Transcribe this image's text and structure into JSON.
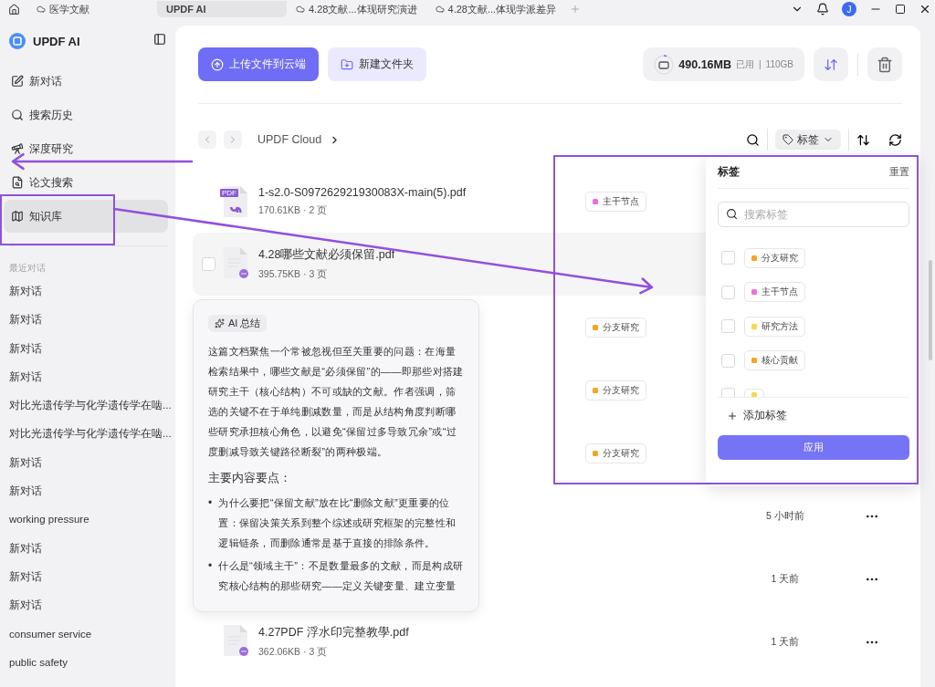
{
  "title_bar": {
    "tabs": [
      {
        "label": "医学文献",
        "selected": false,
        "cloud": true
      },
      {
        "label": "UPDF AI",
        "selected": true,
        "cloud": false
      },
      {
        "label": "4.28文献...体现研究演进",
        "selected": false,
        "cloud": true
      },
      {
        "label": "4.28文献...体现学派差异",
        "selected": false,
        "cloud": true
      }
    ],
    "avatar": "J"
  },
  "sidebar": {
    "app_name": "UPDF AI",
    "nav": [
      {
        "label": "新对话",
        "selected": false
      },
      {
        "label": "搜索历史",
        "selected": false
      },
      {
        "label": "深度研究",
        "selected": false
      },
      {
        "label": "论文搜索",
        "selected": false
      },
      {
        "label": "知识库",
        "selected": true
      }
    ],
    "recent_heading": "最近对话",
    "recent": [
      "新对话",
      "新对话",
      "新对话",
      "新对话",
      "对比光遗传学与化学遗传学在啮...",
      "对比光遗传学与化学遗传学在啮...",
      "新对话",
      "新对话",
      "working pressure",
      "新对话",
      "新对话",
      "新对话",
      "consumer service",
      "public safety"
    ]
  },
  "toolbar": {
    "upload": "上传文件到云端",
    "new_folder": "新建文件夹",
    "storage": {
      "used": "490.16MB",
      "used_label": "已用",
      "separator": "|",
      "total": "110GB"
    }
  },
  "breadcrumb": {
    "path": "UPDF Cloud"
  },
  "tag_filter": "标签",
  "files": [
    {
      "kind": "pdf",
      "badge": "PDF",
      "name": "1-s2.0-S097262921930083X-main(5).pdf",
      "meta": "170.61KB · 2 页",
      "hovered": false,
      "tag": {
        "label": "主干节点",
        "color": "#f06be0"
      }
    },
    {
      "kind": "doc",
      "name": "4.28哪些文献必须保留.pdf",
      "meta": "395.75KB · 3 页",
      "hovered": true
    },
    {
      "tag": {
        "label": "分支研究",
        "color": "#f5a524"
      }
    },
    {
      "tag": {
        "label": "分支研究",
        "color": "#f5a524"
      }
    },
    {
      "tag": {
        "label": "分支研究",
        "color": "#f5a524"
      }
    },
    {
      "hovered": false,
      "time": "5 小时前",
      "has_menu": true
    },
    {
      "hovered": false,
      "time": "1 天前",
      "has_menu": true
    },
    {
      "kind": "doc",
      "name": "4.27PDF 浮水印完整教學.pdf",
      "meta": "362.06KB · 3 页",
      "hovered": false,
      "time": "1 天前",
      "has_menu": true
    }
  ],
  "ai_summary": {
    "chip": "AI 总结",
    "paragraph": "这篇文档聚焦一个常被忽视但至关重要的问题：在海量检索结果中，哪些文献是“必须保留”的——即那些对搭建研究主干（核心结构）不可或缺的文献。作者强调，筛选的关键不在于单纯删减数量，而是从结构角度判断哪些研究承担核心角色，以避免“保留过多导致冗余”或“过度删减导致关键路径断裂”的两种极端。",
    "heading": "主要内容要点：",
    "marker": "•",
    "bullets": [
      "为什么要把“保留文献”放在比“删除文献”更重要的位置：保留决策关系到整个综述或研究框架的完整性和逻辑链条，而删除通常是基于直接的排除条件。",
      "什么是“领域主干”：不是数量最多的文献，而是构成研究核心结构的那些研究——定义关键变量、建立变量"
    ]
  },
  "tag_panel": {
    "title": "标签",
    "reset": "重置",
    "search": {
      "placeholder": "搜索标签"
    },
    "tags": [
      {
        "label": "分支研究",
        "color": "#f5a524",
        "checked": false
      },
      {
        "label": "主干节点",
        "color": "#f06be0",
        "checked": false
      },
      {
        "label": "研究方法",
        "color": "#f7d84a",
        "checked": false
      },
      {
        "label": "核心贡献",
        "color": "#f5a524",
        "checked": false
      },
      {
        "color": "#f7d84a",
        "checked": false
      }
    ],
    "add": "添加标签",
    "apply": "应用"
  },
  "annotations": [
    {
      "kind": "frame"
    },
    {
      "kind": "frame"
    },
    {
      "kind": "arrow"
    },
    {
      "kind": "arrow"
    }
  ]
}
